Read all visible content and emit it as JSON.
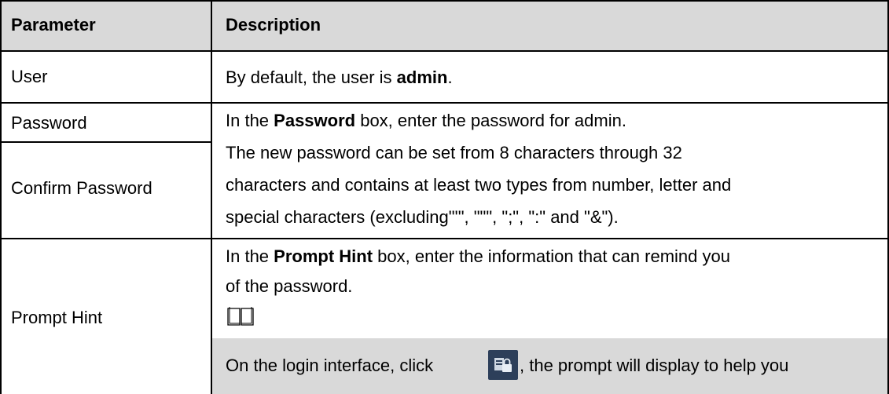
{
  "table": {
    "headers": {
      "parameter": "Parameter",
      "description": "Description"
    },
    "rows": {
      "user": {
        "parameter": "User",
        "desc_pre": "By default, the user is ",
        "desc_bold": "admin",
        "desc_post": "."
      },
      "password": {
        "parameter": "Password",
        "line1_pre": "In the ",
        "line1_bold": "Password",
        "line1_post": " box, enter the password for admin.",
        "line2": "The new password can be set from 8 characters through 32",
        "line3": "characters and contains at least two types from number, letter and",
        "line4": "special characters (excluding\"'\", \"\"\", \";\", \":\" and \"&\")."
      },
      "confirm_password": {
        "parameter": "Confirm Password"
      },
      "prompt_hint": {
        "parameter": "Prompt Hint",
        "line1_pre": "In the ",
        "line1_bold": "Prompt Hint",
        "line1_post": " box, enter the information that can remind you",
        "line2": "of the password.",
        "note_icon": "book-icon",
        "note_pre": "On the login interface, click ",
        "note_icon2": "prompt-hint-icon",
        "note_post": ", the prompt will display to help you"
      }
    }
  }
}
